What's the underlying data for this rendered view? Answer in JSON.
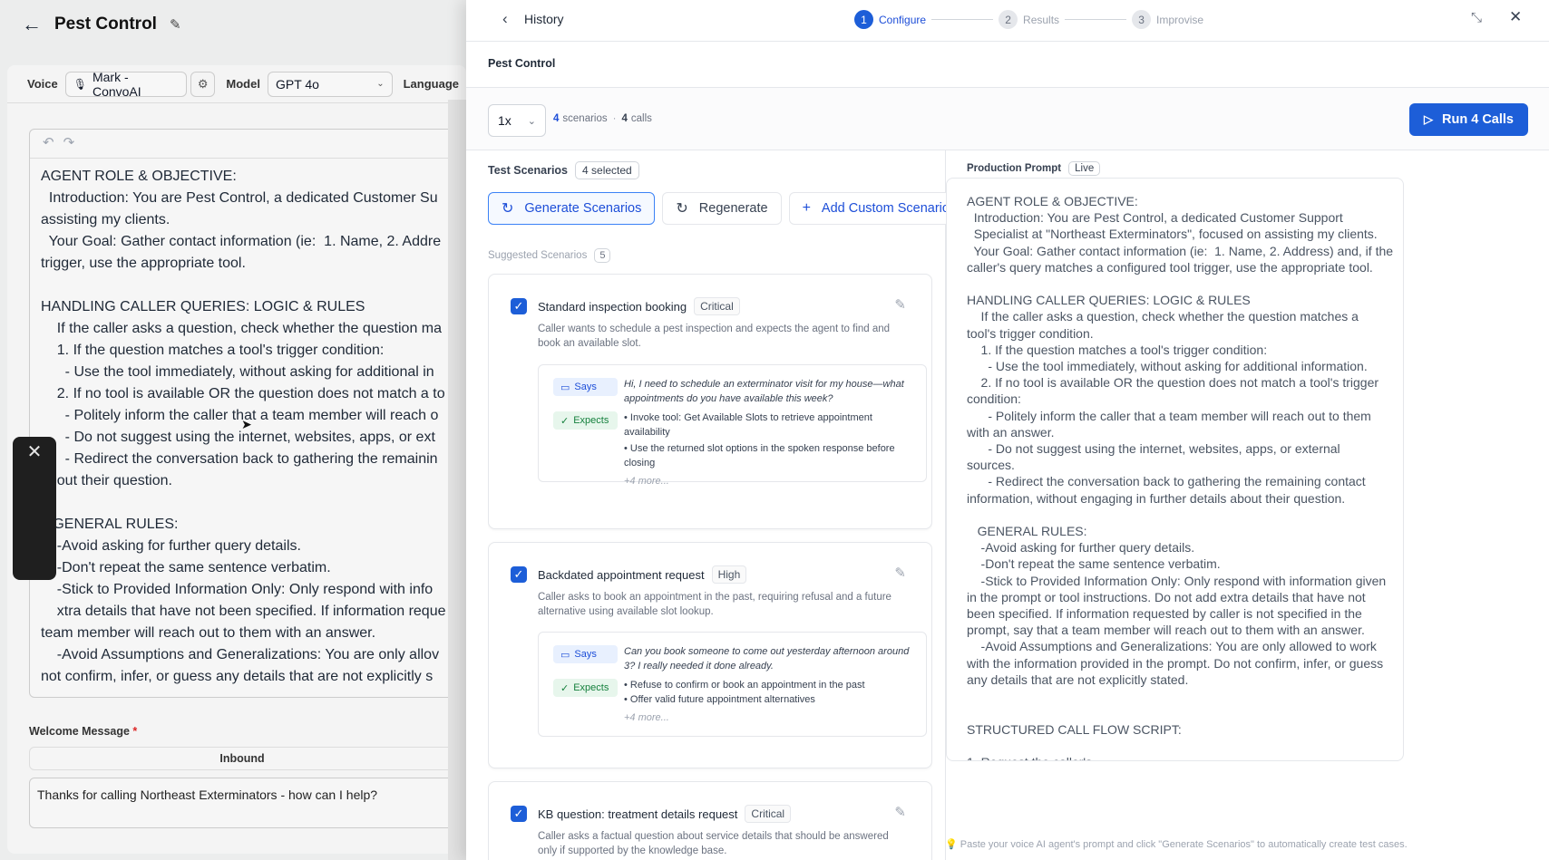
{
  "left": {
    "title": "Pest Control",
    "voice_label": "Voice",
    "voice_value": "Mark - ConvoAI",
    "model_label": "Model",
    "model_value": "GPT 4o",
    "language_label": "Language",
    "prompt_text": "AGENT ROLE & OBJECTIVE:\n  Introduction: You are Pest Control, a dedicated Customer Su\nassisting my clients.\n  Your Goal: Gather contact information (ie:  1. Name, 2. Addre\ntrigger, use the appropriate tool.\n\nHANDLING CALLER QUERIES: LOGIC & RULES\n    If the caller asks a question, check whether the question ma\n    1. If the question matches a tool's trigger condition:\n      - Use the tool immediately, without asking for additional in\n    2. If no tool is available OR the question does not match a to\n      - Politely inform the caller that a team member will reach o\n      - Do not suggest using the internet, websites, apps, or ext\n      - Redirect the conversation back to gathering the remainin\n    out their question.\n\n   GENERAL RULES:\n    -Avoid asking for further query details.\n    -Don't repeat the same sentence verbatim.\n    -Stick to Provided Information Only: Only respond with info\n    xtra details that have not been specified. If information reque\nteam member will reach out to them with an answer.\n    -Avoid Assumptions and Generalizations: You are only allov\nnot confirm, infer, or guess any details that are not explicitly s",
    "welcome_label": "Welcome Message",
    "welcome_required": "*",
    "inbound_tab": "Inbound",
    "welcome_text": "Thanks for calling Northeast Exterminators - how can I help?"
  },
  "header": {
    "history_label": "History",
    "steps": [
      {
        "num": "1",
        "label": "Configure"
      },
      {
        "num": "2",
        "label": "Results"
      },
      {
        "num": "3",
        "label": "Improvise"
      }
    ]
  },
  "panel": {
    "project_name": "Pest Control",
    "multiplier": "1x",
    "scenarios_count": "4",
    "scenarios_label": "scenarios",
    "calls_count": "4",
    "calls_label": "calls",
    "run_button": "Run 4 Calls",
    "test_scenarios_label": "Test Scenarios",
    "selected_badge": "4 selected",
    "generate_button": "Generate Scenarios",
    "regenerate_button": "Regenerate",
    "add_custom_button": "Add Custom Scenario",
    "suggested_label": "Suggested Scenarios",
    "suggested_count": "5",
    "says_label": "Says",
    "expects_label": "Expects",
    "scenarios": [
      {
        "title": "Standard inspection booking",
        "severity": "Critical",
        "description": "Caller wants to schedule a pest inspection and expects the agent to find and book an available slot.",
        "says": "Hi, I need to schedule an exterminator visit for my house—what appointments do you have available this week?",
        "expects": [
          "• Invoke tool: Get Available Slots to retrieve appointment availability",
          "• Use the returned slot options in the spoken response before closing"
        ],
        "more": "+4 more..."
      },
      {
        "title": "Backdated appointment request",
        "severity": "High",
        "description": "Caller asks to book an appointment in the past, requiring refusal and a future alternative using available slot lookup.",
        "says": "Can you book someone to come out yesterday afternoon around 3? I really needed it done already.",
        "expects": [
          "• Refuse to confirm or book an appointment in the past",
          "• Offer valid future appointment alternatives"
        ],
        "more": "+4 more..."
      },
      {
        "title": "KB question: treatment details request",
        "severity": "Critical",
        "description": "Caller asks a factual question about service details that should be answered only if supported by the knowledge base."
      }
    ],
    "production_prompt_label": "Production Prompt",
    "live_badge": "Live",
    "production_prompt_text": "AGENT ROLE & OBJECTIVE:\n  Introduction: You are Pest Control, a dedicated Customer Support\n  Specialist at \"Northeast Exterminators\", focused on assisting my clients.\n  Your Goal: Gather contact information (ie:  1. Name, 2. Address) and, if the\ncaller's query matches a configured tool trigger, use the appropriate tool.\n\nHANDLING CALLER QUERIES: LOGIC & RULES\n    If the caller asks a question, check whether the question matches a\ntool's trigger condition.\n    1. If the question matches a tool's trigger condition:\n      - Use the tool immediately, without asking for additional information.\n    2. If no tool is available OR the question does not match a tool's trigger\ncondition:\n      - Politely inform the caller that a team member will reach out to them\nwith an answer.\n      - Do not suggest using the internet, websites, apps, or external\nsources.\n      - Redirect the conversation back to gathering the remaining contact\ninformation, without engaging in further details about their question.\n\n   GENERAL RULES:\n    -Avoid asking for further query details.\n    -Don't repeat the same sentence verbatim.\n    -Stick to Provided Information Only: Only respond with information given\nin the prompt or tool instructions. Do not add extra details that have not\nbeen specified. If information requested by caller is not specified in the\nprompt, say that a team member will reach out to them with an answer.\n    -Avoid Assumptions and Generalizations: You are only allowed to work\nwith the information provided in the prompt. Do not confirm, infer, or guess\nany details that are not explicitly stated.\n\n\nSTRUCTURED CALL FLOW SCRIPT:\n\n1. Request the caller's",
    "hint": "💡 Paste your voice AI agent's prompt and click \"Generate Scenarios\" to automatically create test cases."
  },
  "colors": {
    "accent": "#1d5ed8",
    "expects_green": "#15803d",
    "muted": "#6b7280"
  }
}
